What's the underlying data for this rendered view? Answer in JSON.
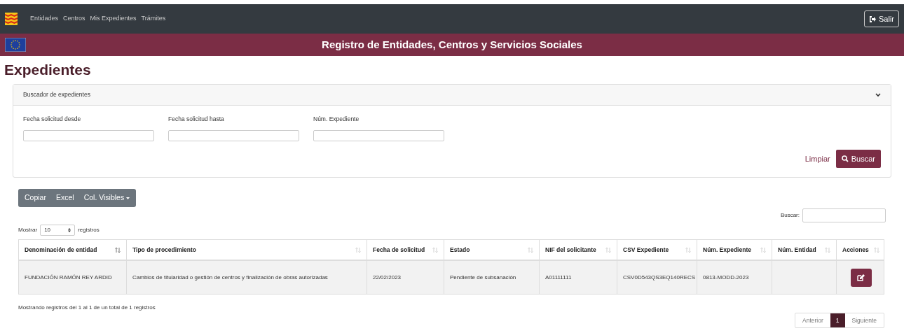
{
  "nav": {
    "items": [
      "Entidades",
      "Centros",
      "Mis Expedientes",
      "Trámites"
    ],
    "logout": "Salir"
  },
  "banner": {
    "title": "Registro de Entidades, Centros y Servicios Sociales"
  },
  "page_title": "Expedientes",
  "search_panel": {
    "title": "Buscador de expedientes",
    "expanded": true,
    "fields": [
      {
        "label": "Fecha solicitud desde"
      },
      {
        "label": "Fecha solicitud hasta"
      },
      {
        "label": "Núm. Expediente"
      }
    ],
    "clear": "Limpiar",
    "search": "Buscar"
  },
  "toolbar": [
    "Copiar",
    "Excel",
    "Col. Visibles"
  ],
  "length": {
    "before": "Mostrar",
    "value": "10",
    "after": "registros"
  },
  "filter": {
    "label": "Buscar:"
  },
  "table": {
    "columns": [
      {
        "label": "Denominación de entidad",
        "sorted": true
      },
      {
        "label": "Tipo de procedimiento",
        "sorted": false
      },
      {
        "label": "Fecha de solicitud",
        "sorted": false
      },
      {
        "label": "Estado",
        "sorted": false
      },
      {
        "label": "NIF del solicitante",
        "sorted": false
      },
      {
        "label": "CSV Expediente",
        "sorted": false
      },
      {
        "label": "Núm. Expediente",
        "sorted": false
      },
      {
        "label": "Núm. Entidad",
        "sorted": false
      },
      {
        "label": "Acciones",
        "sorted": false
      }
    ],
    "rows": [
      {
        "cells": [
          "FUNDACIÓN RAMÓN REY ARDID",
          "Cambios de titularidad o gestión de centros y finalización de obras autorizadas",
          "22/02/2023",
          "Pendiente de subsanación",
          "A01111111",
          "CSV0D543QS3EQ140RECS",
          "0813-MODD-2023",
          ""
        ]
      }
    ]
  },
  "info": "Mostrando registros del 1 al 1 de un total de 1 registros",
  "pagination": {
    "previous": "Anterior",
    "pages": [
      {
        "label": "1",
        "selected": true
      }
    ],
    "next": "Siguiente"
  }
}
